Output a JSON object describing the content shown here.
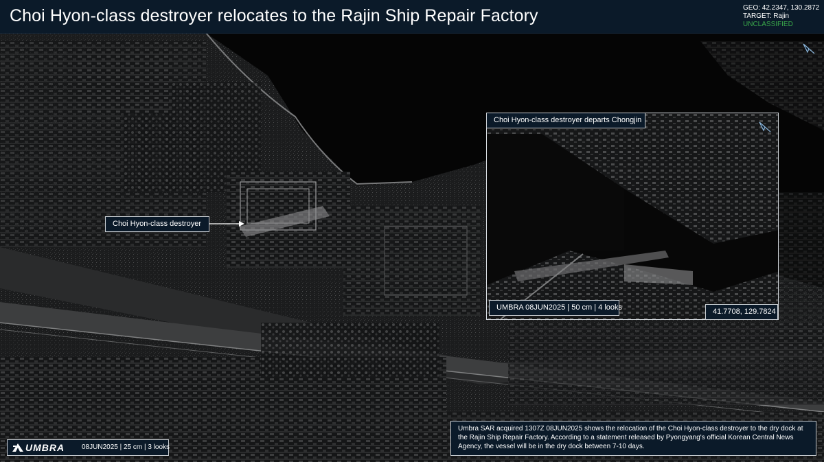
{
  "header": {
    "title": "Choi Hyon-class destroyer relocates to the Rajin Ship Repair Factory",
    "geo": "GEO:  42.2347, 130.2872",
    "target": "TARGET: Rajin",
    "classification": "UNCLASSIFIED"
  },
  "main_image": {
    "annotation": "Choi Hyon-class destroyer",
    "north_arrow": "north-arrow-icon"
  },
  "inset": {
    "title": "Choi Hyon-class destroyer departs Chongjin",
    "acquisition": "UMBRA 08JUN2025 | 50 cm | 4 looks",
    "coordinates": "41.7708, 129.7824",
    "north_arrow": "north-arrow-icon"
  },
  "caption": {
    "text": "Umbra SAR acquired 1307Z 08JUN2025 shows the relocation of the Choi Hyon-class destroyer to the dry dock at the Rajin Ship Repair Factory. According to a statement released by Pyongyang's official Korean Central News Agency, the vessel will be in the dry dock between 7-10 days."
  },
  "footer": {
    "logo": "UMBRA",
    "acquisition": "08JUN2025 | 25 cm | 3 looks"
  },
  "colors": {
    "panel": "#0b1a29",
    "classification": "#3aa84a",
    "border": "#c8cdd2"
  }
}
